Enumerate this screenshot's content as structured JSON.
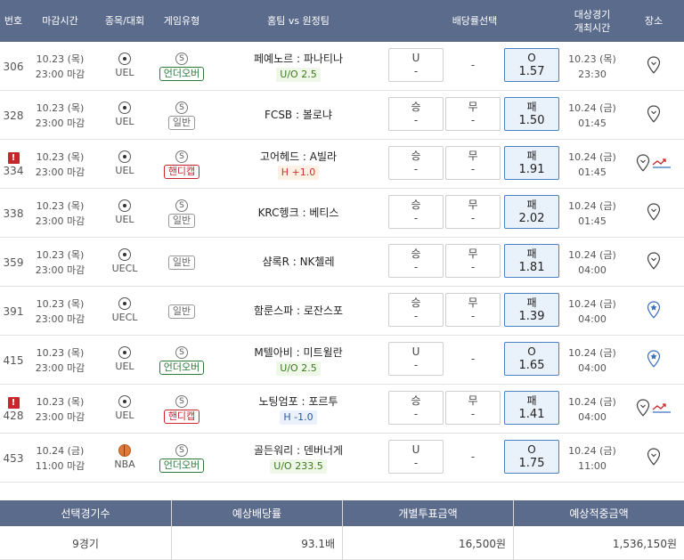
{
  "header": {
    "no": "번호",
    "deadline": "마감시간",
    "sport": "종목/대회",
    "gametype": "게임유형",
    "matchup": "홈팀 vs 원정팀",
    "odds": "배당률선택",
    "target_date_1": "대상경기",
    "target_date_2": "개최시간",
    "venue": "장소"
  },
  "rows": [
    {
      "no": "306",
      "alert": "",
      "date": "10.23 (목)",
      "deadline": "23:00 마감",
      "league": "UEL",
      "sport_icon": "soccer-ball-icon",
      "sym": "S",
      "type": "언더오버",
      "type_class": "ou",
      "home": "페예노르",
      "away": "파나티나",
      "tag": "U/O 2.5",
      "tag_class": "ou",
      "b1_top": "U",
      "b1_bot": "-",
      "b2_top": "-",
      "b2_bot": "",
      "b3_top": "O",
      "b3_bot": "1.57",
      "sel": 3,
      "b2_plain": true,
      "game_date": "10.23 (목)",
      "game_time": "23:30",
      "venue_icon": "map-pin-icon",
      "trend": false
    },
    {
      "no": "328",
      "alert": "",
      "date": "10.23 (목)",
      "deadline": "23:00 마감",
      "league": "UEL",
      "sport_icon": "soccer-ball-icon",
      "sym": "S",
      "type": "일반",
      "type_class": "ge",
      "home": "FCSB",
      "away": "볼로냐",
      "tag": "",
      "tag_class": "",
      "b1_top": "승",
      "b1_bot": "-",
      "b2_top": "무",
      "b2_bot": "-",
      "b3_top": "패",
      "b3_bot": "1.50",
      "sel": 3,
      "b2_plain": false,
      "game_date": "10.24 (금)",
      "game_time": "01:45",
      "venue_icon": "map-pin-icon",
      "trend": false
    },
    {
      "no": "334",
      "alert": "!",
      "date": "10.23 (목)",
      "deadline": "23:00 마감",
      "league": "UEL",
      "sport_icon": "soccer-ball-icon",
      "sym": "S",
      "type": "핸디캡",
      "type_class": "hc",
      "home": "고어헤드",
      "away": "A빌라",
      "tag": "H +1.0",
      "tag_class": "hp",
      "b1_top": "승",
      "b1_bot": "-",
      "b2_top": "무",
      "b2_bot": "-",
      "b3_top": "패",
      "b3_bot": "1.91",
      "sel": 3,
      "b2_plain": false,
      "game_date": "10.24 (금)",
      "game_time": "01:45",
      "venue_icon": "map-pin-icon",
      "trend": true
    },
    {
      "no": "338",
      "alert": "",
      "date": "10.23 (목)",
      "deadline": "23:00 마감",
      "league": "UEL",
      "sport_icon": "soccer-ball-icon",
      "sym": "S",
      "type": "일반",
      "type_class": "ge",
      "home": "KRC헹크",
      "away": "베티스",
      "tag": "",
      "tag_class": "",
      "b1_top": "승",
      "b1_bot": "-",
      "b2_top": "무",
      "b2_bot": "-",
      "b3_top": "패",
      "b3_bot": "2.02",
      "sel": 3,
      "b2_plain": false,
      "game_date": "10.24 (금)",
      "game_time": "01:45",
      "venue_icon": "map-pin-icon",
      "trend": false
    },
    {
      "no": "359",
      "alert": "",
      "date": "10.23 (목)",
      "deadline": "23:00 마감",
      "league": "UECL",
      "sport_icon": "soccer-ball-icon",
      "sym": "",
      "type": "일반",
      "type_class": "ge",
      "home": "샴록R",
      "away": "NK첼레",
      "tag": "",
      "tag_class": "",
      "b1_top": "승",
      "b1_bot": "-",
      "b2_top": "무",
      "b2_bot": "-",
      "b3_top": "패",
      "b3_bot": "1.81",
      "sel": 3,
      "b2_plain": false,
      "game_date": "10.24 (금)",
      "game_time": "04:00",
      "venue_icon": "map-pin-icon",
      "trend": false
    },
    {
      "no": "391",
      "alert": "",
      "date": "10.23 (목)",
      "deadline": "23:00 마감",
      "league": "UECL",
      "sport_icon": "soccer-ball-icon",
      "sym": "",
      "type": "일반",
      "type_class": "ge",
      "home": "함룬스파",
      "away": "로잔스포",
      "tag": "",
      "tag_class": "",
      "b1_top": "승",
      "b1_bot": "-",
      "b2_top": "무",
      "b2_bot": "-",
      "b3_top": "패",
      "b3_bot": "1.39",
      "sel": 3,
      "b2_plain": false,
      "game_date": "10.24 (금)",
      "game_time": "04:00",
      "venue_icon": "star-pin-icon",
      "trend": false
    },
    {
      "no": "415",
      "alert": "",
      "date": "10.23 (목)",
      "deadline": "23:00 마감",
      "league": "UEL",
      "sport_icon": "soccer-ball-icon",
      "sym": "S",
      "type": "언더오버",
      "type_class": "ou",
      "home": "M텔아비",
      "away": "미트윌란",
      "tag": "U/O 2.5",
      "tag_class": "ou",
      "b1_top": "U",
      "b1_bot": "-",
      "b2_top": "-",
      "b2_bot": "",
      "b3_top": "O",
      "b3_bot": "1.65",
      "sel": 3,
      "b2_plain": true,
      "game_date": "10.24 (금)",
      "game_time": "04:00",
      "venue_icon": "star-pin-icon",
      "trend": false
    },
    {
      "no": "428",
      "alert": "!",
      "date": "10.23 (목)",
      "deadline": "23:00 마감",
      "league": "UEL",
      "sport_icon": "soccer-ball-icon",
      "sym": "S",
      "type": "핸디캡",
      "type_class": "hc",
      "home": "노팅엄포",
      "away": "포르투",
      "tag": "H -1.0",
      "tag_class": "hm",
      "b1_top": "승",
      "b1_bot": "-",
      "b2_top": "무",
      "b2_bot": "-",
      "b3_top": "패",
      "b3_bot": "1.41",
      "sel": 3,
      "b2_plain": false,
      "game_date": "10.24 (금)",
      "game_time": "04:00",
      "venue_icon": "map-pin-icon",
      "trend": true
    },
    {
      "no": "453",
      "alert": "",
      "date": "10.24 (금)",
      "deadline": "11:00 마감",
      "league": "NBA",
      "sport_icon": "basketball-icon",
      "sym": "S",
      "type": "언더오버",
      "type_class": "ou",
      "home": "골든워리",
      "away": "덴버너게",
      "tag": "U/O 233.5",
      "tag_class": "ou",
      "b1_top": "U",
      "b1_bot": "-",
      "b2_top": "-",
      "b2_bot": "",
      "b3_top": "O",
      "b3_bot": "1.75",
      "sel": 3,
      "b2_plain": true,
      "game_date": "10.24 (금)",
      "game_time": "11:00",
      "venue_icon": "map-pin-icon",
      "trend": false
    }
  ],
  "summary": {
    "headers": [
      "선택경기수",
      "예상배당률",
      "개별투표금액",
      "예상적중금액"
    ],
    "values": [
      "9경기",
      "93.1배",
      "16,500원",
      "1,536,150원"
    ]
  },
  "colors": {
    "header_bg": "#5b6b8c",
    "selected_border": "#4d7fc4",
    "selected_bg": "#e9f1fb",
    "alert": "#c9252c"
  }
}
